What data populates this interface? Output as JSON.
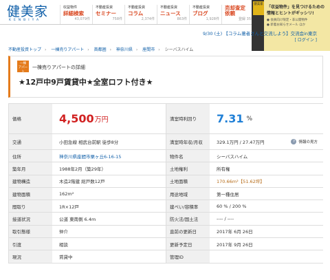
{
  "header": {
    "logo_text": "健美家",
    "logo_sub": "KENBIYA",
    "nav": [
      {
        "cat": "収益物件",
        "label": "詳細検索",
        "count": "43,079件",
        "color": "#d9461f"
      },
      {
        "cat": "不動産投資",
        "label": "セミナー",
        "count": "758件",
        "color": "#d9461f"
      },
      {
        "cat": "不動産投資",
        "label": "コラム",
        "count": "2,374件",
        "color": "#d9461f"
      },
      {
        "cat": "不動産投資",
        "label": "ニュース",
        "count": "863件",
        "color": "#d9461f"
      },
      {
        "cat": "不動産投資",
        "label": "ブログ",
        "count": "1,928件",
        "color": "#d9461f"
      },
      {
        "cat": "",
        "label": "売却査定\n依頼",
        "count": "登録 35社",
        "color": "#d9461f"
      }
    ]
  },
  "ad": {
    "badge": "健美家",
    "title": "「収益物件」を見つけるための\n情報とヒントがギッシリ!",
    "items": [
      "● 会員向け限定・非公開物件",
      "● 新着お知らせメール ほか"
    ]
  },
  "event_bar": "9/30 (土) 【コラム著者さんと交流しよう】交流会in東京",
  "login_link": "[ ログイン ]",
  "breadcrumb": [
    "不動産投資トップ",
    "一棟売りアパート",
    "首都圏",
    "神奈川県",
    "座間市",
    "シーバスハイム"
  ],
  "title_box": {
    "badge": "一棟\nアパート",
    "subtitle": "一棟売りアパートの詳細",
    "title": "★12戸中9戸賃貸中★全室ロフト付き★"
  },
  "price": {
    "label": "価格",
    "value": "4,500",
    "unit": "万円"
  },
  "yield": {
    "label": "満室時利回り",
    "value": "7.31",
    "unit": "%"
  },
  "rows": [
    [
      {
        "label": "交通",
        "value": "小田急線 相武台前駅 徒歩8分"
      },
      {
        "label": "満室時年収/月収",
        "value": "329.1万円 / 27.47万円"
      }
    ],
    [
      {
        "label": "住所",
        "value": "神奈川県座間市栗ヶ丘6-16-15"
      },
      {
        "label": "物件名",
        "value": "シーバスハイム"
      }
    ],
    [
      {
        "label": "築年月",
        "value": "1988年2月（築29年）"
      },
      {
        "label": "土地権利",
        "value": "所有権"
      }
    ],
    [
      {
        "label": "建物構造",
        "value": "木造2階建 総戸数12戸"
      },
      {
        "label": "土地面積",
        "value": "170.66m²【51.62坪】"
      }
    ],
    [
      {
        "label": "建物面積",
        "value": "162m²"
      },
      {
        "label": "用途地域",
        "value": "第一種住居"
      }
    ],
    [
      {
        "label": "間取り",
        "value": "1R×12戸"
      },
      {
        "label": "建ぺい/容積率",
        "value": "60 % / 200 %"
      }
    ],
    [
      {
        "label": "接道状況",
        "value": "公道 東南側 6.4m"
      },
      {
        "label": "防火法/国土法",
        "value": "---- / ----"
      }
    ],
    [
      {
        "label": "取引態様",
        "value": "仲介"
      },
      {
        "label": "直前の更新日",
        "value": "2017年 6月 26日"
      }
    ],
    [
      {
        "label": "引渡",
        "value": "相談"
      },
      {
        "label": "更新予定日",
        "value": "2017年 9月 26日"
      }
    ],
    [
      {
        "label": "現況",
        "value": "賃貸中"
      },
      {
        "label": "管理ID",
        "value": ""
      }
    ]
  ],
  "help_label": "情報の見方",
  "help_icon": "?"
}
